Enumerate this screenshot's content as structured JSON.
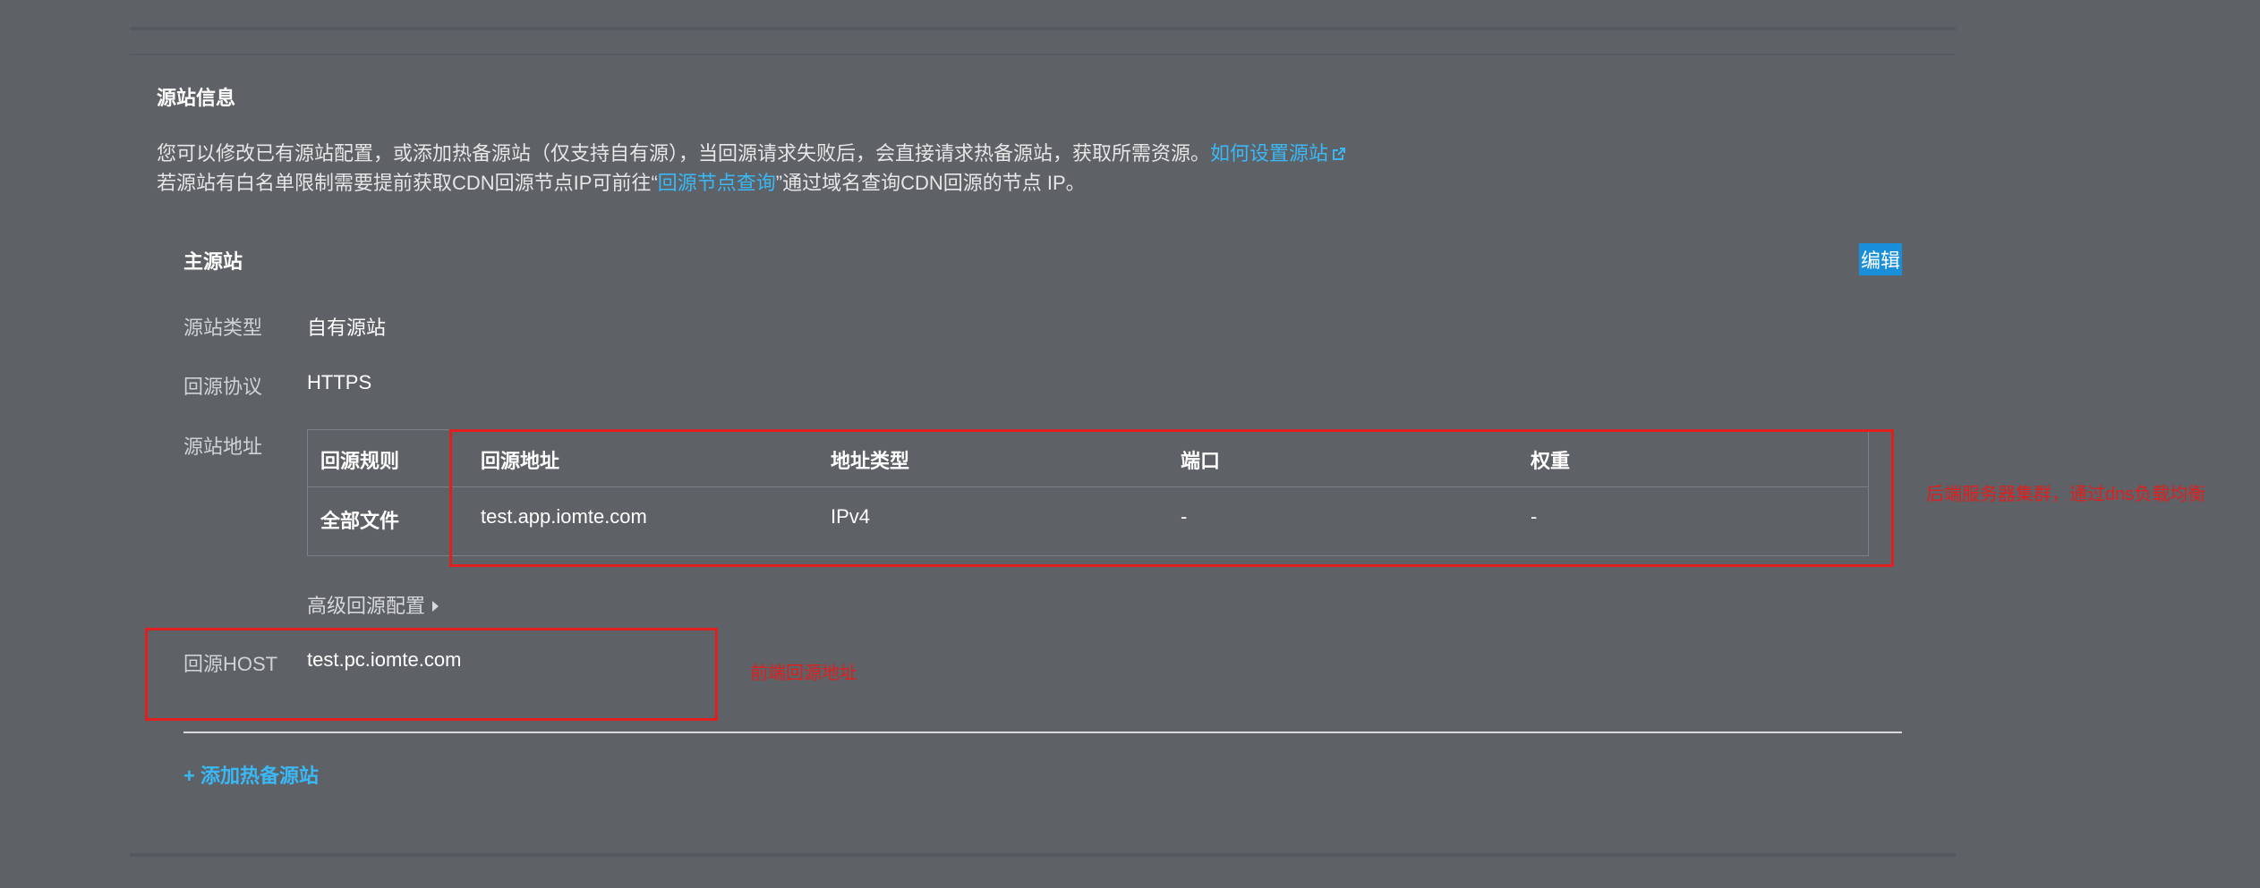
{
  "section": {
    "title": "源站信息",
    "desc_line1": "您可以修改已有源站配置，或添加热备源站（仅支持自有源），当回源请求失败后，会直接请求热备源站，获取所需资源。",
    "desc_link1": "如何设置源站",
    "desc_line2_pre": "若源站有白名单限制需要提前获取CDN回源节点IP可前往“",
    "desc_link2": "回源节点查询",
    "desc_line2_post": "”通过域名查询CDN回源的节点 IP。"
  },
  "primary": {
    "title": "主源站",
    "edit_label": "编辑",
    "type_label": "源站类型",
    "type_value": "自有源站",
    "protocol_label": "回源协议",
    "protocol_value": "HTTPS",
    "address_label": "源站地址",
    "table": {
      "headers": [
        "回源规则",
        "回源地址",
        "地址类型",
        "端口",
        "权重"
      ],
      "rows": [
        [
          "全部文件",
          "test.app.iomte.com",
          "IPv4",
          "-",
          "-"
        ]
      ]
    },
    "advanced_label": "高级回源配置",
    "host_label": "回源HOST",
    "host_value": "test.pc.iomte.com",
    "add_hot_backup_label": "+ 添加热备源站"
  },
  "annotations": {
    "right_note": "后端服务器集群，通过dns负载均衡",
    "host_note": "前端回源地址"
  },
  "icons": {
    "external_link": "external-link-icon",
    "advanced_toggle": "caret-right-icon"
  },
  "colors": {
    "background": "#5e6166",
    "link": "#3ab8f5",
    "edit_highlight": "#1a8fd9",
    "annotation_red": "#e01f1f"
  }
}
